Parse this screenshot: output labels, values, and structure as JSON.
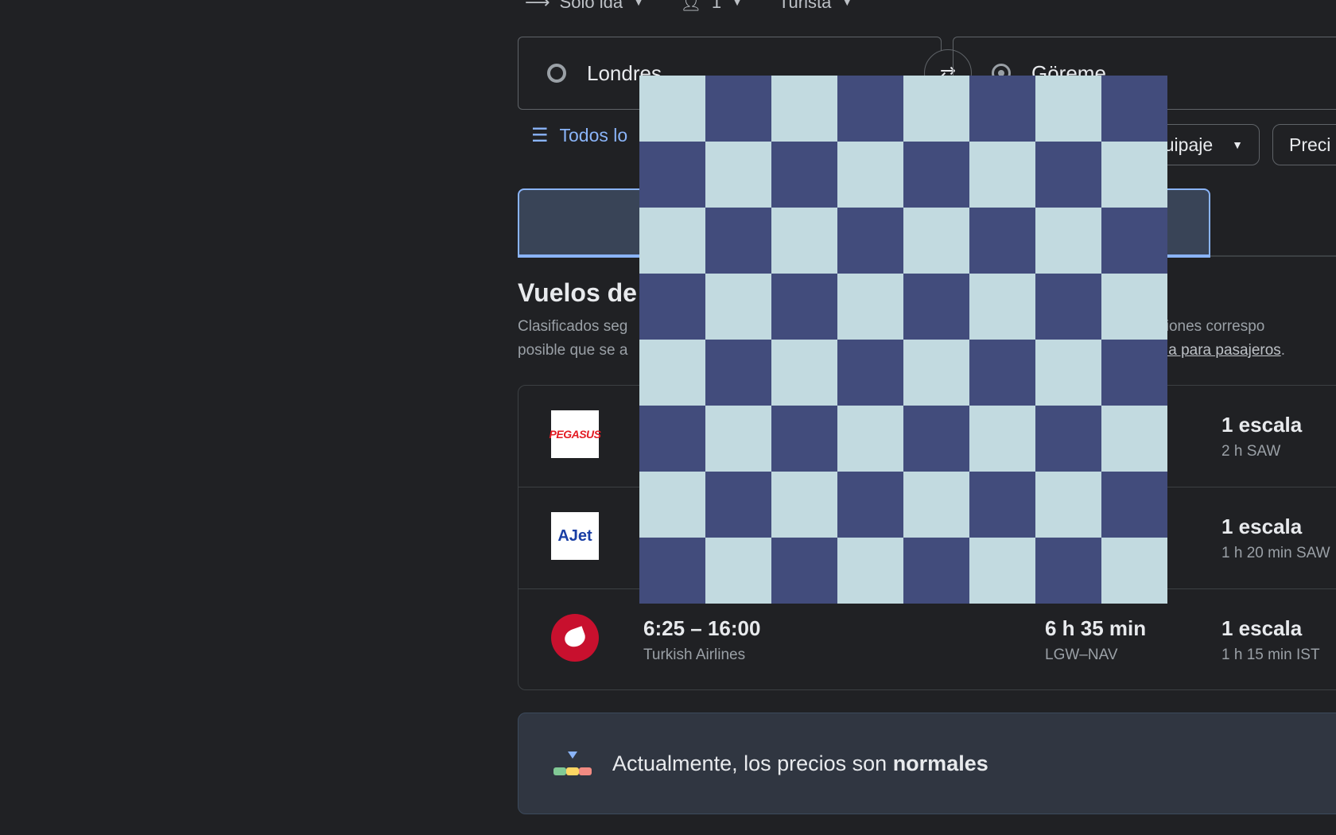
{
  "trip_bar": {
    "trip_type": "Solo ida",
    "passengers": "1",
    "cabin_class": "Turista"
  },
  "search": {
    "origin": "Londres",
    "destination": "Göreme"
  },
  "filters": {
    "all_filters_label": "Todos lo",
    "bags_label": "uipaje",
    "price_label": "Preci"
  },
  "results": {
    "title": "Vuelos de",
    "desc_line1_start": "Clasificados seg",
    "desc_line1_end": "s comisiones correspo",
    "desc_line2_start": "posible que se a",
    "desc_line2_link": "encia para pasajeros",
    "desc_line2_end": "."
  },
  "flights": [
    {
      "airline_logo": "PEGASUS",
      "times": "",
      "airline": "",
      "duration": "",
      "route": "",
      "stops": "1 escala",
      "stop_detail": "2 h SAW"
    },
    {
      "airline_logo": "AJet",
      "times": "",
      "airline": "",
      "duration": "",
      "route": "",
      "stops": "1 escala",
      "stop_detail": "1 h 20 min SAW"
    },
    {
      "airline_logo": "turkish-airlines-logo",
      "times": "6:25 – 16:00",
      "airline": "Turkish Airlines",
      "duration": "6 h 35 min",
      "route": "LGW–NAV",
      "stops": "1 escala",
      "stop_detail": "1 h 15 min IST"
    }
  ],
  "price_insight": {
    "text_prefix": "Actualmente, los precios son ",
    "text_bold": "normales"
  },
  "overlay": {
    "colors": {
      "light": "#c2dae0",
      "dark": "#424c7c"
    }
  }
}
